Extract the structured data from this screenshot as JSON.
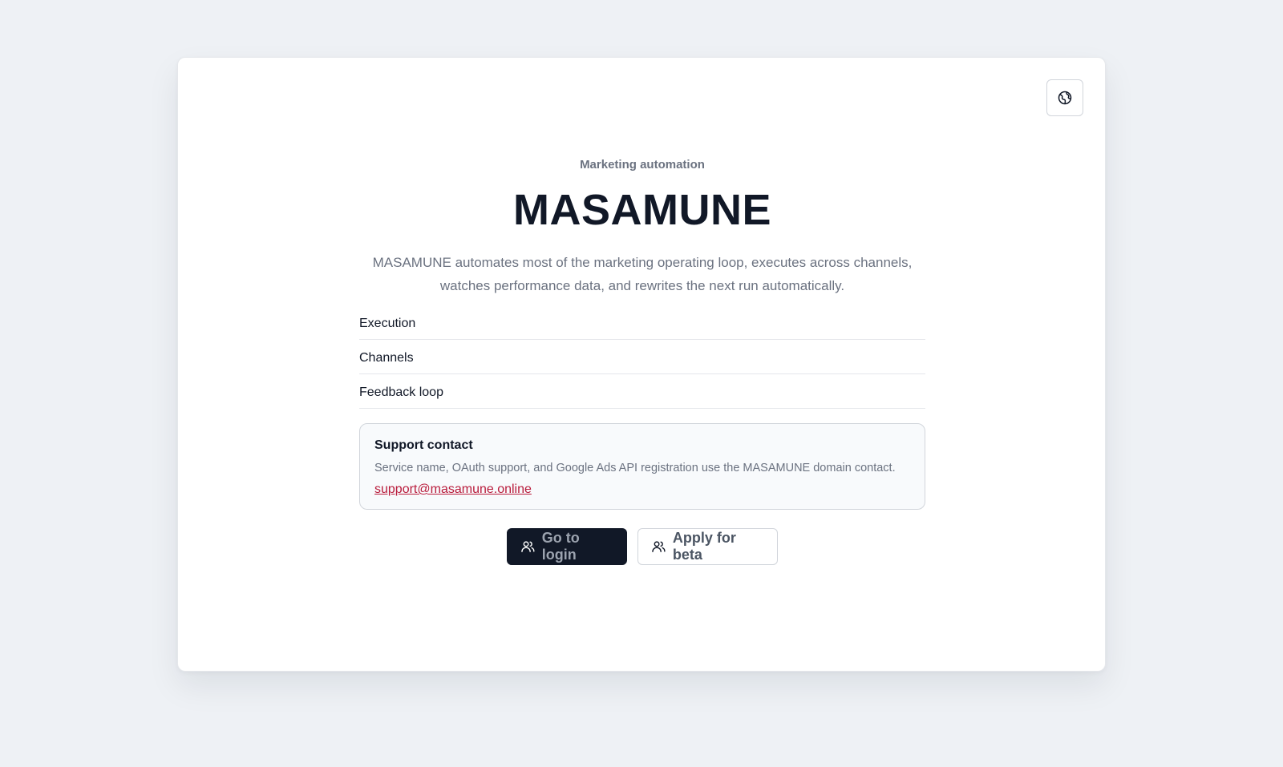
{
  "page": {
    "eyebrow": "Marketing automation",
    "title": "MASAMUNE",
    "description": "MASAMUNE automates most of the marketing operating loop, executes across channels, watches performance data, and rewrites the next run automatically."
  },
  "header": {
    "language_icon": "globe-icon"
  },
  "features": [
    {
      "label": "Execution"
    },
    {
      "label": "Channels"
    },
    {
      "label": "Feedback loop"
    }
  ],
  "support": {
    "title": "Support contact",
    "text": "Service name, OAuth support, and Google Ads API registration use the MASAMUNE domain contact.",
    "email": "support@masamune.online"
  },
  "actions": {
    "login_label": "Go to login",
    "login_icon": "users-icon",
    "beta_label": "Apply for beta",
    "beta_icon": "users-icon"
  },
  "colors": {
    "background": "#eef1f5",
    "card": "#ffffff",
    "primary_button": "#111827",
    "link": "#b91c3c",
    "muted_text": "#6b7280"
  }
}
